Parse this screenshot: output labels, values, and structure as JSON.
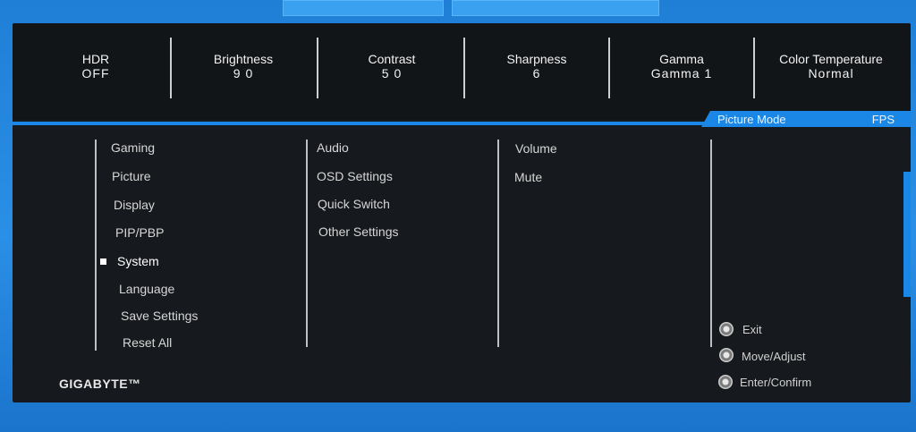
{
  "header": {
    "stats": [
      {
        "label": "HDR",
        "value": "OFF"
      },
      {
        "label": "Brightness",
        "value": "9 0"
      },
      {
        "label": "Contrast",
        "value": "5 0"
      },
      {
        "label": "Sharpness",
        "value": "6"
      },
      {
        "label": "Gamma",
        "value": "Gamma 1"
      },
      {
        "label": "Color Temperature",
        "value": "Normal"
      }
    ]
  },
  "mode": {
    "label": "Picture Mode",
    "value": "FPS"
  },
  "menu": {
    "main": [
      "Gaming",
      "Picture",
      "Display",
      "PIP/PBP",
      "System",
      "Language",
      "Save Settings",
      "Reset All"
    ],
    "selected": "System",
    "sub": [
      "Audio",
      "OSD Settings",
      "Quick Switch",
      "Other Settings"
    ],
    "sub2": [
      "Volume",
      "Mute"
    ]
  },
  "brand": "GIGABYTE™",
  "hints": [
    {
      "label": "Exit",
      "icon": "joystick-icon"
    },
    {
      "label": "Move/Adjust",
      "icon": "joystick-icon"
    },
    {
      "label": "Enter/Confirm",
      "icon": "joystick-icon"
    }
  ],
  "colors": {
    "accent": "#1a86e6",
    "panel": "#16191d"
  }
}
